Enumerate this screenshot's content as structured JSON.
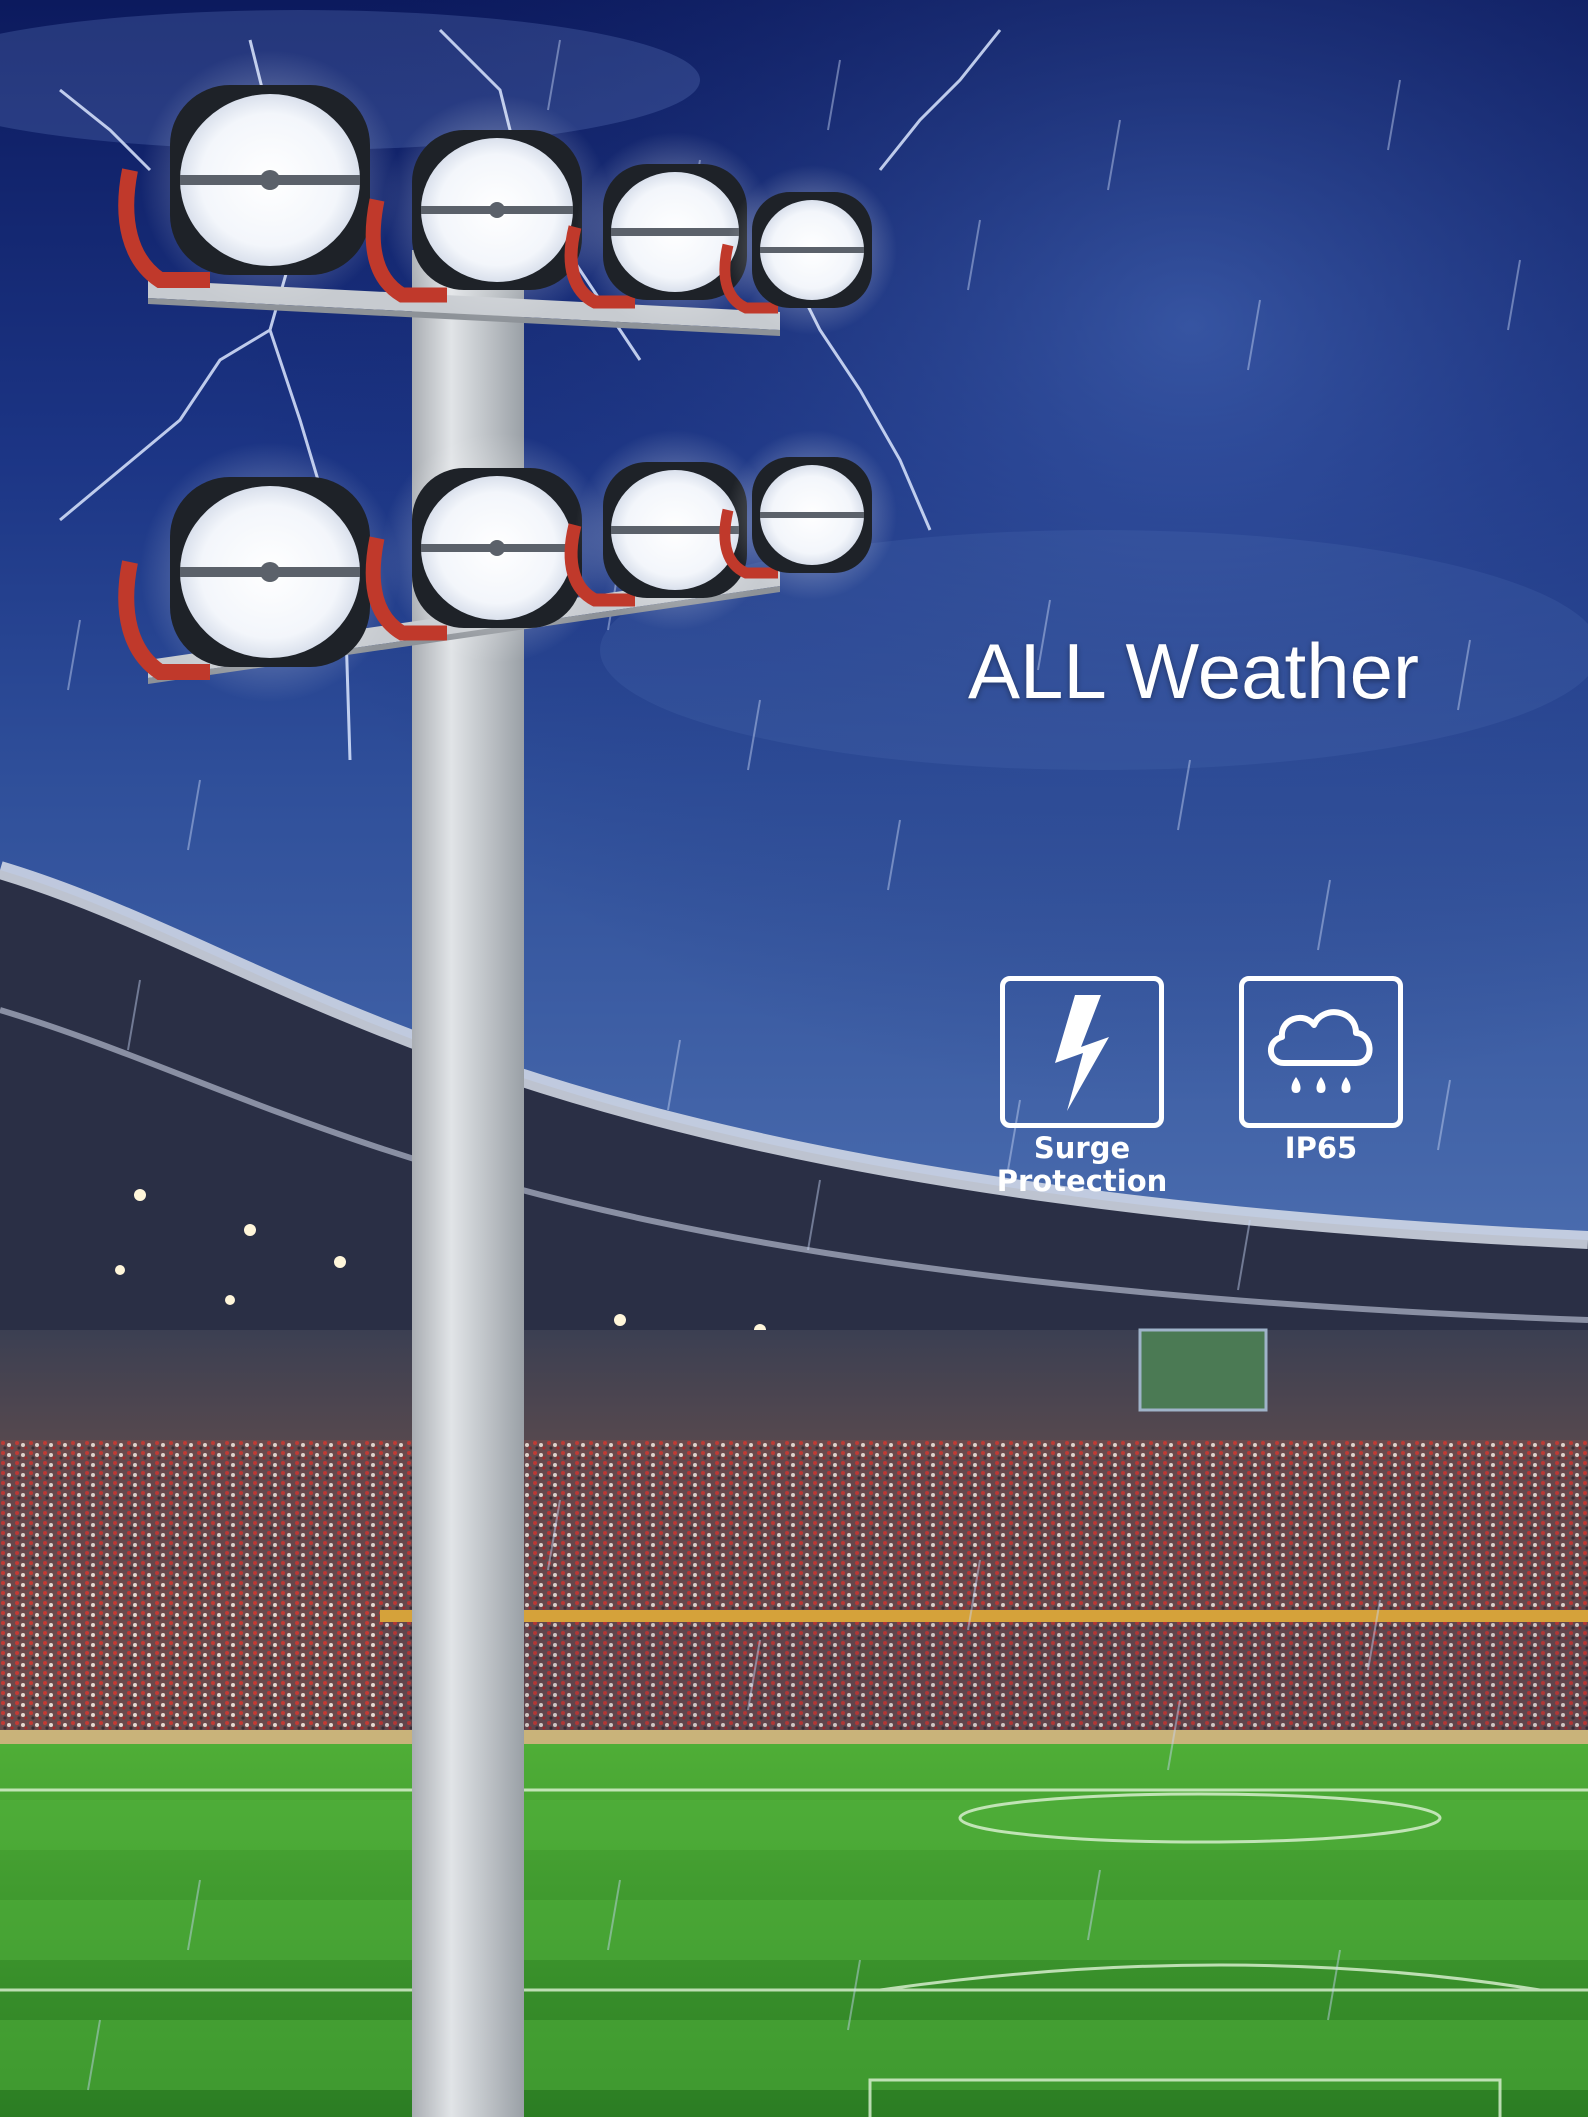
{
  "headline": "ALL Weather",
  "features": [
    {
      "label": "Surge\nProtection",
      "icon": "lightning-bolt-icon"
    },
    {
      "label": "IP65",
      "icon": "rain-cloud-icon"
    }
  ],
  "colors": {
    "sky_top": "#0e1f6a",
    "sky_mid": "#24408f",
    "pitch": "#3a9a2e",
    "lamp_arm": "#c0392b",
    "pole": "#c9cdd1"
  }
}
